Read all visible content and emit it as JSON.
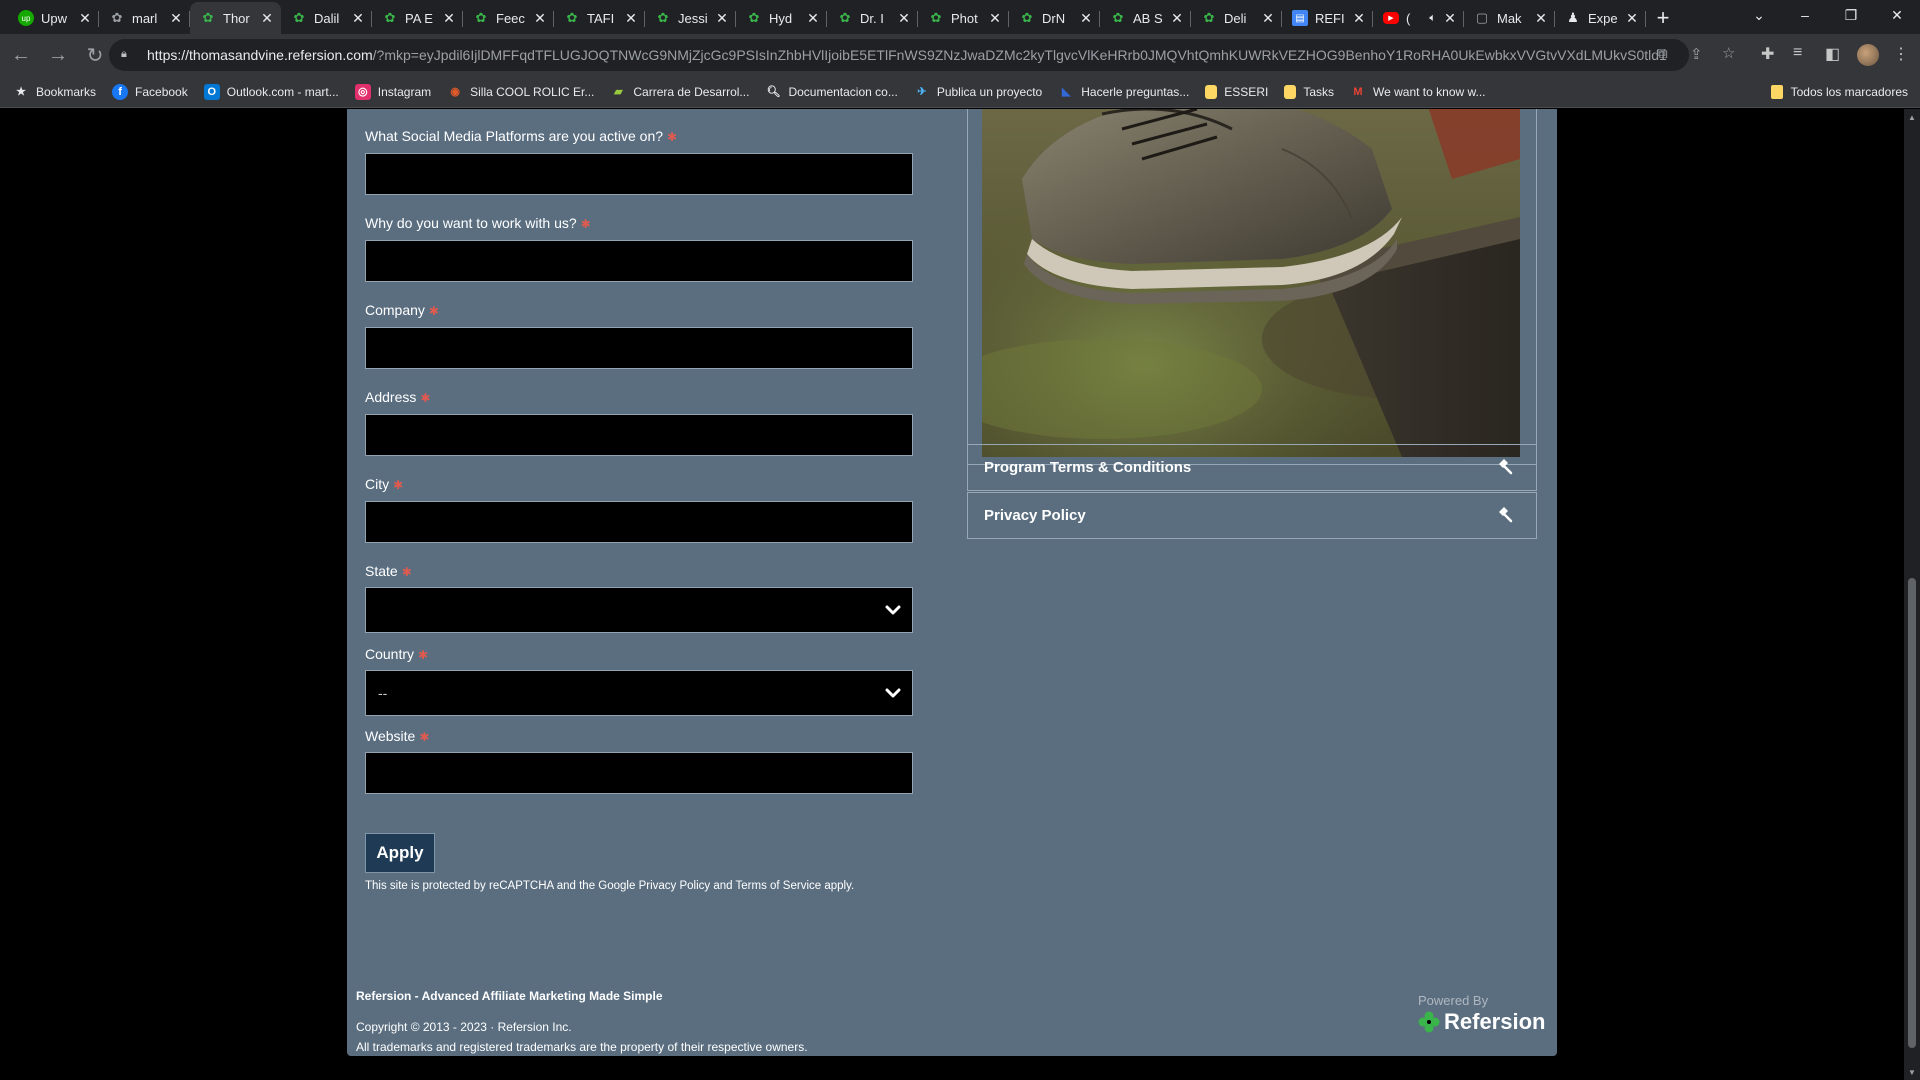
{
  "browser": {
    "tabs": [
      {
        "title": "Upw",
        "favicon": "upwork-icon",
        "color": "#14a800",
        "active": false
      },
      {
        "title": "marl",
        "favicon": "refersion-gear-icon",
        "color": "#9aa0a6",
        "active": false
      },
      {
        "title": "Thor",
        "favicon": "refersion-clover-icon",
        "color": "#39b54a",
        "active": true
      },
      {
        "title": "Dalil",
        "favicon": "refersion-clover-icon",
        "color": "#39b54a",
        "active": false
      },
      {
        "title": "PA E",
        "favicon": "refersion-clover-icon",
        "color": "#39b54a",
        "active": false
      },
      {
        "title": "Feec",
        "favicon": "refersion-clover-icon",
        "color": "#39b54a",
        "active": false
      },
      {
        "title": "TAFI",
        "favicon": "refersion-clover-icon",
        "color": "#39b54a",
        "active": false
      },
      {
        "title": "Jessi",
        "favicon": "refersion-clover-icon",
        "color": "#39b54a",
        "active": false
      },
      {
        "title": "Hyd",
        "favicon": "refersion-clover-icon",
        "color": "#39b54a",
        "active": false
      },
      {
        "title": "Dr. I",
        "favicon": "refersion-clover-icon",
        "color": "#39b54a",
        "active": false
      },
      {
        "title": "Phot",
        "favicon": "refersion-clover-icon",
        "color": "#39b54a",
        "active": false
      },
      {
        "title": "DrN",
        "favicon": "refersion-clover-icon",
        "color": "#39b54a",
        "active": false
      },
      {
        "title": "AB S",
        "favicon": "refersion-clover-icon",
        "color": "#39b54a",
        "active": false
      },
      {
        "title": "Deli",
        "favicon": "refersion-clover-icon",
        "color": "#39b54a",
        "active": false
      },
      {
        "title": "REFI",
        "favicon": "google-docs-icon",
        "color": "#4285f4",
        "active": false
      },
      {
        "title": "(",
        "favicon": "youtube-icon",
        "color": "#ff0000",
        "active": false
      },
      {
        "title": "Mak",
        "favicon": "page-icon",
        "color": "#9aa0a6",
        "active": false
      },
      {
        "title": "Expe",
        "favicon": "person-icon",
        "color": "#e8eaed",
        "active": false
      }
    ],
    "url_domain": "https://thomasandvine.refersion.com",
    "url_rest": "/?mkp=eyJpdil6IjlDMFFqdTFLUGJOQTNWcG9NMjZjcGc9PSIsInZhbHVlIjoibE5ETlFnWS9ZNzJwaDZMc2kyTlgvcVlKeHRrb0JMQVhtQmhKUWRkVEZHOG9BenhoY1RoRHA0UkEwbkxVVGtvVXdLMUkvS0tld1krNW...",
    "bookmarks": [
      {
        "label": "Bookmarks",
        "icon": "star-icon",
        "color": "#e8eaed"
      },
      {
        "label": "Facebook",
        "icon": "facebook-icon",
        "color": "#1877f2"
      },
      {
        "label": "Outlook.com - mart...",
        "icon": "outlook-icon",
        "color": "#0078d4"
      },
      {
        "label": "Instagram",
        "icon": "instagram-icon",
        "color": "#e1306c"
      },
      {
        "label": "Silla COOL ROLIC Er...",
        "icon": "silla-icon",
        "color": "#e05a2a"
      },
      {
        "label": "Carrera de Desarrol...",
        "icon": "platzi-icon",
        "color": "#98ca3f"
      },
      {
        "label": "Documentacion co...",
        "icon": "search-doc-icon",
        "color": "#e8eaed"
      },
      {
        "label": "Publica un proyecto",
        "icon": "workana-icon",
        "color": "#4bb5f5"
      },
      {
        "label": "Hacerle preguntas...",
        "icon": "bookmark-blue-icon",
        "color": "#3367d6"
      },
      {
        "label": "ESSERI",
        "icon": "folder-icon",
        "color": "#fdd663"
      },
      {
        "label": "Tasks",
        "icon": "folder-icon",
        "color": "#fdd663"
      },
      {
        "label": "We want to know w...",
        "icon": "gmail-icon",
        "color": "#ea4335"
      }
    ],
    "all_bookmarks_label": "Todos los marcadores"
  },
  "form": {
    "fields": [
      {
        "label": "What Social Media Platforms are you active on?",
        "required_mark": "✱",
        "type": "text",
        "value": ""
      },
      {
        "label": "Why do you want to work with us?",
        "required_mark": "✱",
        "type": "text",
        "value": ""
      },
      {
        "label": "Company",
        "required_mark": "✱",
        "type": "text",
        "value": ""
      },
      {
        "label": "Address",
        "required_mark": "✱",
        "type": "text",
        "value": ""
      },
      {
        "label": "City",
        "required_mark": "✱",
        "type": "text",
        "value": ""
      },
      {
        "label": "State",
        "required_mark": "✱",
        "type": "select",
        "value": ""
      },
      {
        "label": "Country",
        "required_mark": "✱",
        "type": "select",
        "value": "--"
      },
      {
        "label": "Website",
        "required_mark": "✱",
        "type": "text",
        "value": ""
      }
    ],
    "apply_label": "Apply",
    "recaptcha_text": "This site is protected by reCAPTCHA and the Google Privacy Policy and Terms of Service apply."
  },
  "sidebar": {
    "accordions": [
      {
        "label": "Program Terms & Conditions",
        "icon": "hammer-icon"
      },
      {
        "label": "Privacy Policy",
        "icon": "hammer-icon"
      }
    ]
  },
  "footer": {
    "title": "Refersion - Advanced Affiliate Marketing Made Simple",
    "copyright": "Copyright © 2013 - 2023 · Refersion Inc.",
    "trademarks": "All trademarks and registered trademarks are the property of their respective owners.",
    "powered_by": "Powered By",
    "brand": "Refersion",
    "brand_color": "#39b54a"
  }
}
